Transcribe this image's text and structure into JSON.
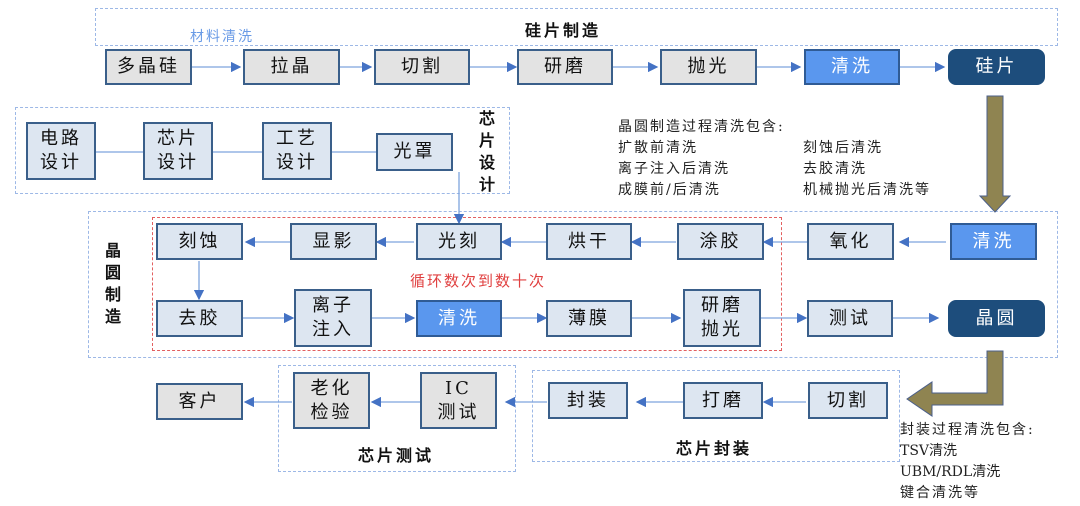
{
  "colors": {
    "clean_box": "#5a97ee",
    "product_box": "#1d4d7c",
    "arrow_big": "#8f8451",
    "group_border": "#9db8e6",
    "loop_border": "#e26060",
    "loop_text": "#e04040",
    "material_clean_text": "#6a9be6"
  },
  "wafer_prep": {
    "title": "硅片制造",
    "material_clean_label": "材料清洗",
    "steps": [
      "多晶硅",
      "拉晶",
      "切割",
      "研磨",
      "抛光",
      "清洗",
      "硅片"
    ]
  },
  "chip_design": {
    "title": "芯\n片\n设\n计",
    "steps": [
      "电路\n设计",
      "芯片\n设计",
      "工艺\n设计",
      "光罩"
    ]
  },
  "wafer_clean_note": {
    "heading": "晶圆制造过程清洗包含:",
    "col1": [
      "扩散前清洗",
      "离子注入后清洗",
      "成膜前/后清洗"
    ],
    "col2": [
      "刻蚀后清洗",
      "去胶清洗",
      "机械抛光后清洗等"
    ]
  },
  "wafer_fab": {
    "title": "晶\n圆\n制\n造",
    "loop_label": "循环数次到数十次",
    "row1": [
      "清洗",
      "氧化",
      "涂胶",
      "烘干",
      "光刻",
      "显影",
      "刻蚀"
    ],
    "row2": [
      "去胶",
      "离子\n注入",
      "清洗",
      "薄膜",
      "研磨\n抛光",
      "测试",
      "晶圆"
    ]
  },
  "packaging": {
    "title": "芯片封装",
    "steps": [
      "切割",
      "打磨",
      "封装"
    ]
  },
  "testing": {
    "title": "芯片测试",
    "steps": [
      "IC\n测试",
      "老化\n检验"
    ]
  },
  "customer": "客户",
  "package_clean_note": {
    "heading": "封装过程清洗包含:",
    "items": [
      "TSV清洗",
      "UBM/RDL清洗",
      "键合清洗等"
    ]
  }
}
